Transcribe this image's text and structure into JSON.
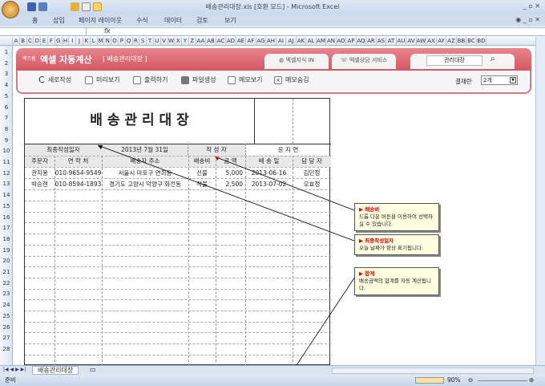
{
  "window": {
    "title": "배송관리대장.xls [호환 모드] - Microsoft Excel"
  },
  "ribbon": {
    "tabs": [
      "홈",
      "삽입",
      "페이지 레이아웃",
      "수식",
      "데이터",
      "검토",
      "보기"
    ]
  },
  "formula": {
    "fx": "fx"
  },
  "columns": [
    "A",
    "B",
    "C",
    "D",
    "E",
    "F",
    "G",
    "H",
    "I",
    "J",
    "K",
    "L",
    "M",
    "N",
    "O",
    "P",
    "Q",
    "R",
    "S",
    "T",
    "U",
    "V",
    "W",
    "X",
    "Y",
    "Z",
    "AA",
    "AB",
    "AC",
    "AD",
    "AE",
    "AF",
    "AG",
    "AH",
    "AI",
    "AJ",
    "AK",
    "AL",
    "AM",
    "AN",
    "AO",
    "AP",
    "AQ",
    "AR",
    "AS",
    "AT",
    "AU",
    "AV",
    "AW",
    "AX",
    "AY",
    "AZ",
    "BB",
    "BC",
    "BD"
  ],
  "rows": [
    "1",
    "2",
    "3",
    "4",
    "5",
    "6",
    "7",
    "8",
    "9",
    "10",
    "11",
    "12",
    "13",
    "14",
    "15",
    "16",
    "17",
    "18",
    "19",
    "20",
    "21",
    "22",
    "23",
    "24",
    "25",
    "26",
    "27",
    "28"
  ],
  "app": {
    "brand_small": "엑즈펌",
    "brand": "엑셀 자동계산",
    "subtitle": "[ 배송관리대장 ]",
    "nav": [
      "엑셀지식 IN",
      "엑셀상담 서비스"
    ],
    "search": "관리대장",
    "tools": [
      "새로작성",
      "미리보기",
      "출력하기",
      "파일생성",
      "메모보기",
      "메모숨김"
    ],
    "approval_label": "결재란",
    "approval_value": "2개"
  },
  "sheet": {
    "title": "배 송 관 리 대 장",
    "date_label": "최종작성일자",
    "date_value": "2013년 7월 31일",
    "author_label": "작 성 자",
    "author_value": "윤 지 연",
    "headers": [
      "주문자",
      "연 락 처",
      "배송자 주소",
      "배송비",
      "금 액",
      "배 송 일",
      "담 당 자"
    ],
    "rows": [
      [
        "권지용",
        "010-9654-9549",
        "서울시 마포구 연희동",
        "선불",
        "5,000",
        "2013-06-16",
        "김민정"
      ],
      [
        "박승현",
        "010-8594-1893",
        "경기도 고양시 덕양구 화전동",
        "착불",
        "2,500",
        "2013-07-02",
        "오효정"
      ]
    ]
  },
  "comments": [
    {
      "title": "배송비",
      "text": "드롭 다운 버튼을 이용하여 선택하실 수 있습니다."
    },
    {
      "title": "최종작성일자",
      "text": "오늘 날짜가 항상 표기됩니다."
    },
    {
      "title": "합계",
      "text": "배송금액의 합계를 자동 계산됩니다."
    }
  ],
  "sheet_tab": "배송관리대장",
  "status": {
    "ready": "준비",
    "zoom": "90%"
  }
}
